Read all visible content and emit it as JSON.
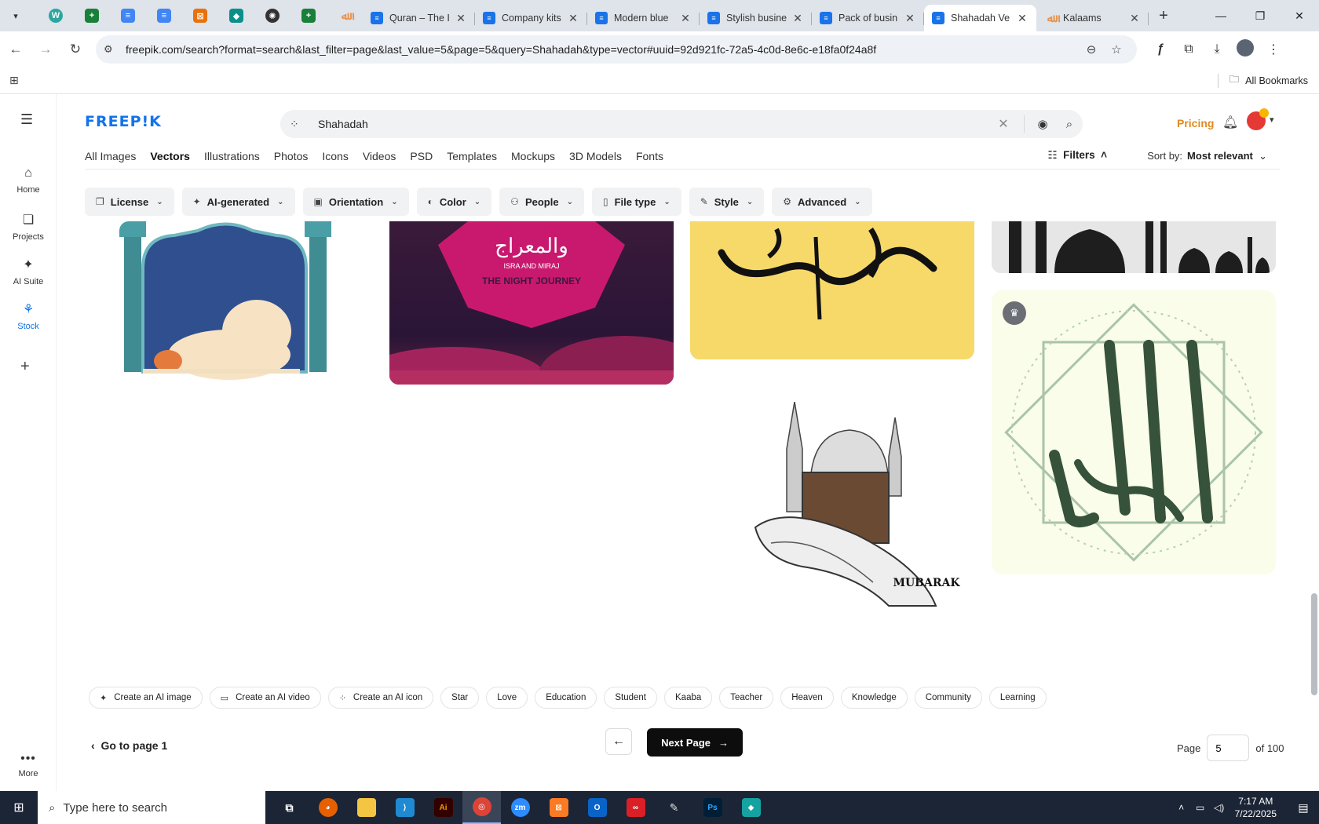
{
  "browser": {
    "tabs": [
      {
        "title": "Quran – The I",
        "fav": "doc"
      },
      {
        "title": "Company kits",
        "fav": "doc"
      },
      {
        "title": "Modern blue",
        "fav": "doc"
      },
      {
        "title": "Stylish busine",
        "fav": "doc"
      },
      {
        "title": "Pack of busin",
        "fav": "doc"
      },
      {
        "title": "Shahadah Ve",
        "fav": "doc",
        "active": true
      },
      {
        "title": "Kalaams",
        "fav": "orange"
      }
    ],
    "url": "freepik.com/search?format=search&last_filter=page&last_value=5&page=5&query=Shahadah&type=vector#uuid=92d921fc-72a5-4c0d-8e6c-e18fa0f24a8f",
    "all_bookmarks": "All Bookmarks"
  },
  "rail": {
    "items": [
      {
        "label": "Home",
        "icon": "home-icon"
      },
      {
        "label": "Projects",
        "icon": "projects-icon"
      },
      {
        "label": "AI Suite",
        "icon": "sparkle-icon"
      },
      {
        "label": "Stock",
        "icon": "stock-icon"
      }
    ],
    "more": "More"
  },
  "header": {
    "logo": "FREEP!K",
    "search_value": "Shahadah",
    "pricing": "Pricing"
  },
  "categories": [
    "All Images",
    "Vectors",
    "Illustrations",
    "Photos",
    "Icons",
    "Videos",
    "PSD",
    "Templates",
    "Mockups",
    "3D Models",
    "Fonts"
  ],
  "active_category": "Vectors",
  "filters_label": "Filters",
  "sort": {
    "label": "Sort by:",
    "value": "Most relevant"
  },
  "filter_chips": [
    "License",
    "AI-generated",
    "Orientation",
    "Color",
    "People",
    "File type",
    "Style",
    "Advanced"
  ],
  "card_texts": {
    "night_journey_small": "ISRA AND MIRAJ",
    "night_journey": "THE NIGHT JOURNEY",
    "mubarak": "MUBARAK"
  },
  "tags": {
    "ai": [
      "Create an AI image",
      "Create an AI video",
      "Create an AI icon"
    ],
    "related": [
      "Star",
      "Love",
      "Education",
      "Student",
      "Kaaba",
      "Teacher",
      "Heaven",
      "Knowledge",
      "Community",
      "Learning"
    ]
  },
  "pagination": {
    "goto": "Go to page 1",
    "next": "Next Page",
    "page_label": "Page",
    "page_value": "5",
    "of_label": "of 100"
  },
  "taskbar": {
    "search_placeholder": "Type here to search",
    "time": "7:17 AM",
    "date": "7/22/2025"
  }
}
